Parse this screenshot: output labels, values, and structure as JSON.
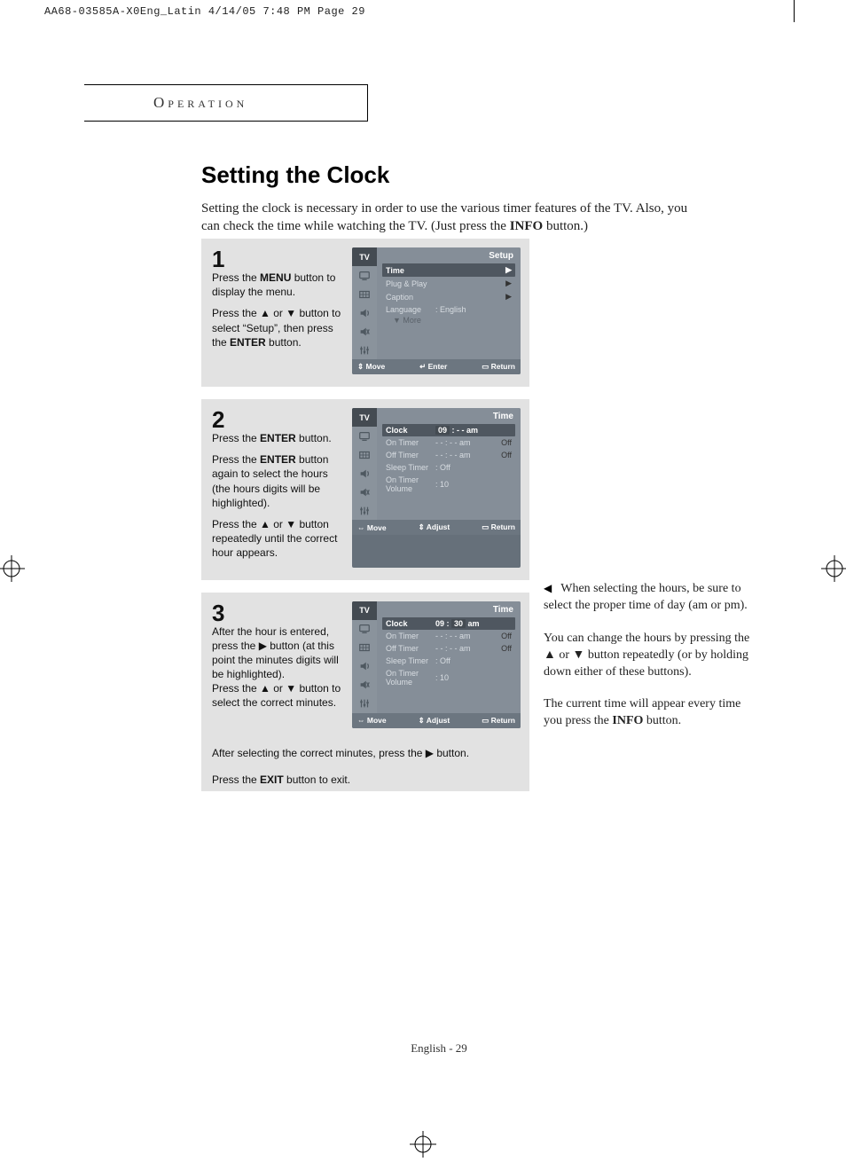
{
  "header_line": "AA68-03585A-X0Eng_Latin  4/14/05  7:48 PM  Page 29",
  "section_label": "Operation",
  "title": "Setting the Clock",
  "intro_html": "Setting the clock is necessary in order to use the various timer features of the TV. Also, you can check the time while watching the TV. (Just press the <strong>INFO</strong> button.)",
  "steps": [
    {
      "num": "1",
      "body_html": "<p>Press the <strong>MENU</strong> button to display the menu.</p><p>Press the ▲ or ▼ button to select “Setup”, then press the <strong>ENTER</strong> button.</p>",
      "osd": {
        "title": "Setup",
        "rows": [
          {
            "label": "Time",
            "right": "▶",
            "hl": true
          },
          {
            "label": "Plug & Play",
            "right": "▶"
          },
          {
            "label": "Caption",
            "right": "▶"
          },
          {
            "label": "Language",
            "mid": ":  English",
            "right": ""
          }
        ],
        "more": "More",
        "bottom": {
          "l": "Move",
          "l_icon": "⇕",
          "m": "Enter",
          "m_icon": "↵",
          "r": "Return",
          "r_icon": "▭"
        }
      }
    },
    {
      "num": "2",
      "body_html": "<p>Press the <strong>ENTER</strong> button.</p><p>Press the <strong>ENTER</strong> button again to select the hours (the hours digits will be highlighted).</p><p>Press the ▲ or ▼ button repeatedly until the correct hour appears.</p>",
      "osd": {
        "title": "Time",
        "rows": [
          {
            "label": "Clock",
            "mid_html": "<span class='hl-span'>09</span> : - -  am",
            "hl": true
          },
          {
            "label": "On Timer",
            "mid": "- - : - -  am",
            "right": "Off"
          },
          {
            "label": "Off Timer",
            "mid": "- - : - -  am",
            "right": "Off"
          },
          {
            "label": "Sleep Timer",
            "mid": ": Off"
          },
          {
            "label": "On Timer Volume",
            "mid": ": 10"
          }
        ],
        "bottom": {
          "l": "Move",
          "l_icon": "⇔",
          "m": "Adjust",
          "m_icon": "⇕",
          "r": "Return",
          "r_icon": "▭"
        }
      }
    },
    {
      "num": "3",
      "body_html": "<p>After the hour is entered, press the ▶ button (at this point the minutes digits will be highlighted).<br>Press the ▲ or ▼ button to select the correct minutes.</p>",
      "extra_html": "<p>After selecting the correct minutes, press the ▶ button.</p><p style='margin-top:14px'>Press the <strong>EXIT</strong> button to exit.</p>",
      "osd": {
        "title": "Time",
        "rows": [
          {
            "label": "Clock",
            "mid_html": "09 : <span class='hl-span'>30</span>  am",
            "hl": true
          },
          {
            "label": "On Timer",
            "mid": "- - : - -  am",
            "right": "Off"
          },
          {
            "label": "Off Timer",
            "mid": "- - : - -  am",
            "right": "Off"
          },
          {
            "label": "Sleep Timer",
            "mid": ": Off"
          },
          {
            "label": "On Timer Volume",
            "mid": ": 10"
          }
        ],
        "bottom": {
          "l": "Move",
          "l_icon": "⇔",
          "m": "Adjust",
          "m_icon": "⇕",
          "r": "Return",
          "r_icon": "▭"
        }
      }
    }
  ],
  "side_notes": [
    {
      "lead": true,
      "html": "When selecting the hours, be sure to select the proper time of day (am or pm)."
    },
    {
      "html": "You can change the hours by pressing the ▲ or ▼ button repeatedly (or by holding down either of these buttons)."
    },
    {
      "html": "The current time will appear every time you press the <strong>INFO</strong> button."
    }
  ],
  "tv_label": "TV",
  "footer": "English - 29"
}
